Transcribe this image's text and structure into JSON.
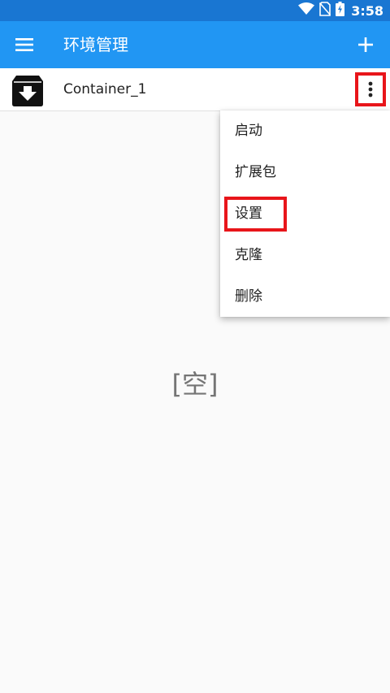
{
  "status_bar": {
    "time": "3:58",
    "icons": [
      "wifi-icon",
      "no-sim-icon",
      "battery-charging-icon"
    ]
  },
  "app_bar": {
    "title": "环境管理",
    "menu_icon": "hamburger-menu-icon",
    "add_icon": "plus-icon"
  },
  "container_list": {
    "items": [
      {
        "name": "Container_1",
        "icon": "archive-download-icon"
      }
    ]
  },
  "context_menu": {
    "items": [
      {
        "label": "启动"
      },
      {
        "label": "扩展包"
      },
      {
        "label": "设置"
      },
      {
        "label": "克隆"
      },
      {
        "label": "删除"
      }
    ],
    "highlighted_item": "设置"
  },
  "empty_state": {
    "text": "[空]"
  },
  "colors": {
    "status_bar": "#1976d2",
    "app_bar": "#2196f3",
    "highlight": "#e8151a",
    "background": "#fafafa"
  }
}
